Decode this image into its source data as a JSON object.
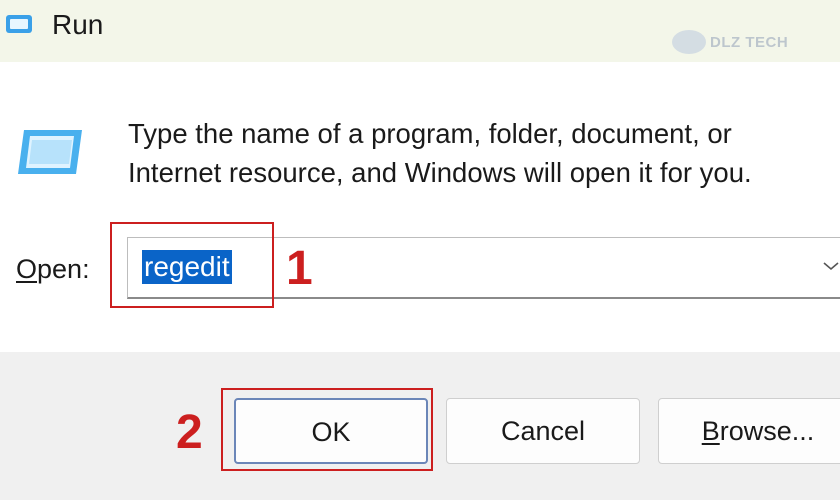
{
  "window": {
    "title": "Run",
    "icon": "run-icon"
  },
  "watermark": {
    "text": "DLZ TECH"
  },
  "dialog": {
    "prompt_line1": "Type the name of a program, folder, document, or",
    "prompt_line2": "Internet resource, and Windows will open it for you.",
    "open_label_accel": "O",
    "open_label_rest": "pen:",
    "open_value": "regedit",
    "dropdown_icon": "chevron-down-icon"
  },
  "annotations": {
    "step1": "1",
    "step2": "2",
    "color": "#cc1f1f"
  },
  "buttons": {
    "ok": "OK",
    "cancel": "Cancel",
    "browse_accel": "B",
    "browse_rest": "rowse..."
  },
  "colors": {
    "titlebar": "#f3f6e9",
    "selection": "#0a64c8",
    "footer": "#f0f0f0"
  }
}
